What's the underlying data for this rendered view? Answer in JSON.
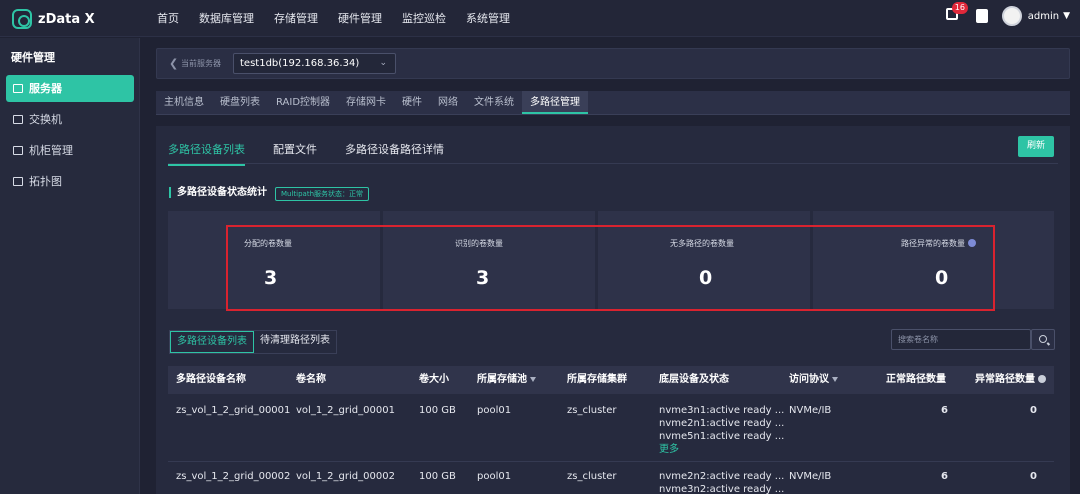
{
  "app": {
    "name": "zData X"
  },
  "nav": [
    "首页",
    "数据库管理",
    "存储管理",
    "硬件管理",
    "监控巡检",
    "系统管理"
  ],
  "header": {
    "notification_count": "16",
    "user": "admin"
  },
  "sidebar": {
    "title": "硬件管理",
    "items": [
      {
        "label": "服务器",
        "icon": "server-icon",
        "active": true
      },
      {
        "label": "交换机",
        "icon": "switch-icon",
        "active": false
      },
      {
        "label": "机柜管理",
        "icon": "cabinet-icon",
        "active": false
      },
      {
        "label": "拓扑图",
        "icon": "topology-icon",
        "active": false
      }
    ]
  },
  "server": {
    "label": "当前服务器",
    "value": "test1db(192.168.36.34)"
  },
  "subtabs": [
    "主机信息",
    "硬盘列表",
    "RAID控制器",
    "存储网卡",
    "硬件",
    "网络",
    "文件系统",
    "多路径管理"
  ],
  "panel": {
    "tabs": [
      "多路径设备列表",
      "配置文件",
      "多路径设备路径详情"
    ],
    "refresh": "刷新",
    "section_title": "多路径设备状态统计",
    "service_status": "Multipath服务状态：正常",
    "stats": [
      {
        "label": "分配的卷数量",
        "value": "3",
        "info": false
      },
      {
        "label": "识别的卷数量",
        "value": "3",
        "info": false
      },
      {
        "label": "无多路径的卷数量",
        "value": "0",
        "info": false
      },
      {
        "label": "路径异常的卷数量",
        "value": "0",
        "info": true
      }
    ],
    "list_tabs": [
      "多路径设备列表",
      "待清理路径列表"
    ],
    "search_placeholder": "搜索卷名称"
  },
  "table": {
    "columns": [
      "多路径设备名称",
      "卷名称",
      "卷大小",
      "所属存储池",
      "所属存储集群",
      "底层设备及状态",
      "访问协议",
      "正常路径数量",
      "异常路径数量"
    ],
    "rows": [
      {
        "device": "zs_vol_1_2_grid_00001",
        "volume": "vol_1_2_grid_00001",
        "size": "100 GB",
        "pool": "pool01",
        "cluster": "zs_cluster",
        "lines": [
          "nvme3n1:active ready ...",
          "nvme2n1:active ready ...",
          "nvme5n1:active ready ..."
        ],
        "more": "更多",
        "protocol": "NVMe/IB",
        "normal": "6",
        "abnormal": "0"
      },
      {
        "device": "zs_vol_1_2_grid_00002",
        "volume": "vol_1_2_grid_00002",
        "size": "100 GB",
        "pool": "pool01",
        "cluster": "zs_cluster",
        "lines": [
          "nvme2n2:active ready ...",
          "nvme3n2:active ready ..."
        ],
        "protocol": "NVMe/IB",
        "normal": "6",
        "abnormal": "0"
      }
    ]
  }
}
